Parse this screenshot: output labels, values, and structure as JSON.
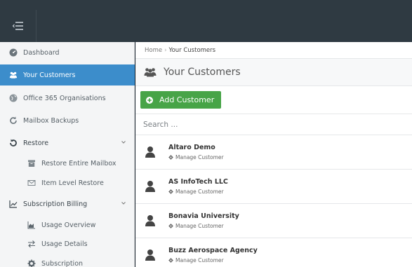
{
  "header": {
    "menu_icon": "menu-collapse-icon"
  },
  "sidebar": {
    "items": [
      {
        "label": "Dashboard",
        "icon": "dashboard-icon"
      },
      {
        "label": "Your Customers",
        "icon": "users-icon",
        "active": true
      },
      {
        "label": "Office 365 Organisations",
        "icon": "globe-icon"
      },
      {
        "label": "Mailbox Backups",
        "icon": "refresh-icon"
      },
      {
        "label": "Restore",
        "icon": "undo-icon",
        "expandable": true
      },
      {
        "label": "Restore Entire Mailbox",
        "icon": "archive-icon",
        "sub": true
      },
      {
        "label": "Item Level Restore",
        "icon": "envelope-icon",
        "sub": true
      },
      {
        "label": "Subscription Billing",
        "icon": "line-chart-icon",
        "expandable": true
      },
      {
        "label": "Usage Overview",
        "icon": "area-chart-icon",
        "sub": true
      },
      {
        "label": "Usage Details",
        "icon": "exchange-icon",
        "sub": true
      },
      {
        "label": "Subscription",
        "icon": "gear-icon",
        "sub": true
      }
    ]
  },
  "breadcrumb": {
    "home": "Home",
    "separator": "›",
    "current": "Your Customers"
  },
  "page": {
    "title": "Your Customers"
  },
  "actions": {
    "add_label": "Add Customer"
  },
  "search": {
    "placeholder": "Search ..."
  },
  "customers": [
    {
      "name": "Altaro Demo",
      "action": "Manage Customer"
    },
    {
      "name": "AS InfoTech LLC",
      "action": "Manage Customer"
    },
    {
      "name": "Bonavia University",
      "action": "Manage Customer"
    },
    {
      "name": "Buzz Aerospace Agency",
      "action": "Manage Customer"
    }
  ],
  "colors": {
    "accent": "#3c8dcb",
    "success": "#47a447",
    "topbar": "#2f3a42"
  }
}
